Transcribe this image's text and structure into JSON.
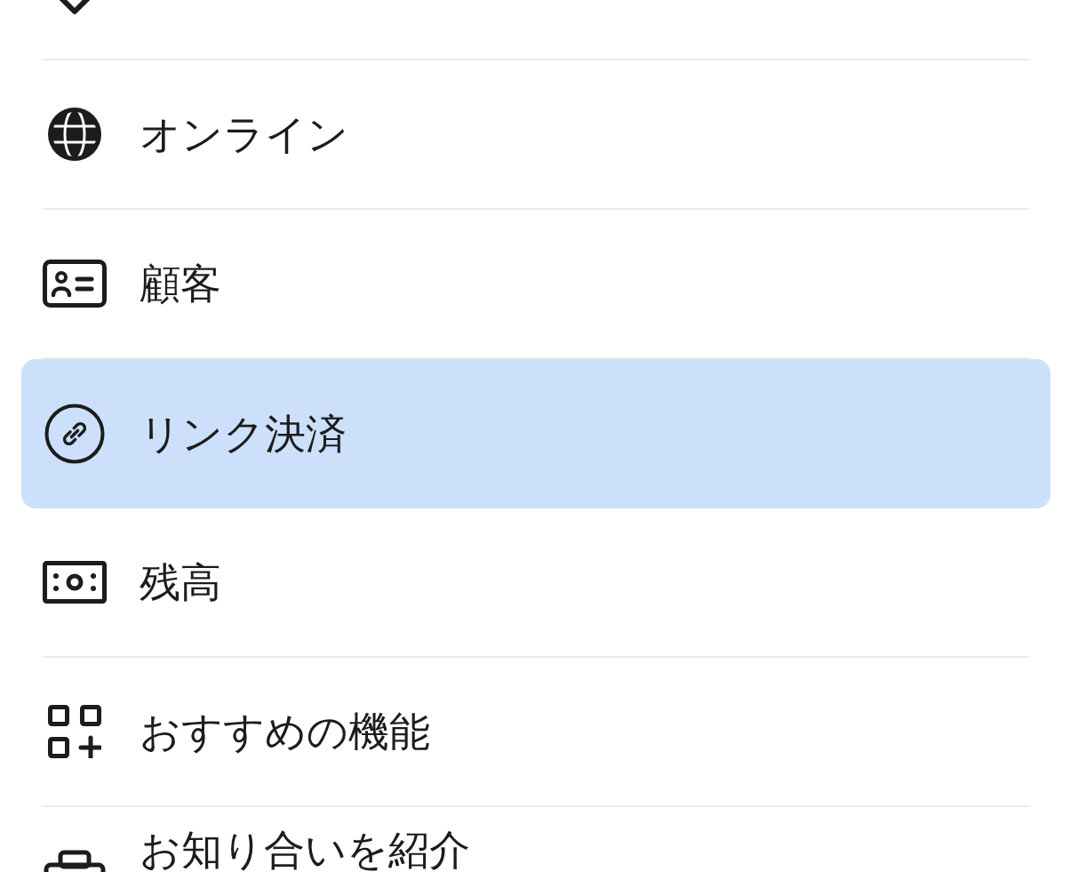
{
  "menu": {
    "items": [
      {
        "selected": false
      },
      {
        "label": "オンライン",
        "selected": false
      },
      {
        "label": "顧客",
        "selected": false
      },
      {
        "label": "リンク決済",
        "selected": true
      },
      {
        "label": "残高",
        "selected": false
      },
      {
        "label": "おすすめの機能",
        "selected": false
      },
      {
        "label": "お知り合いを紹介",
        "selected": false
      }
    ]
  }
}
